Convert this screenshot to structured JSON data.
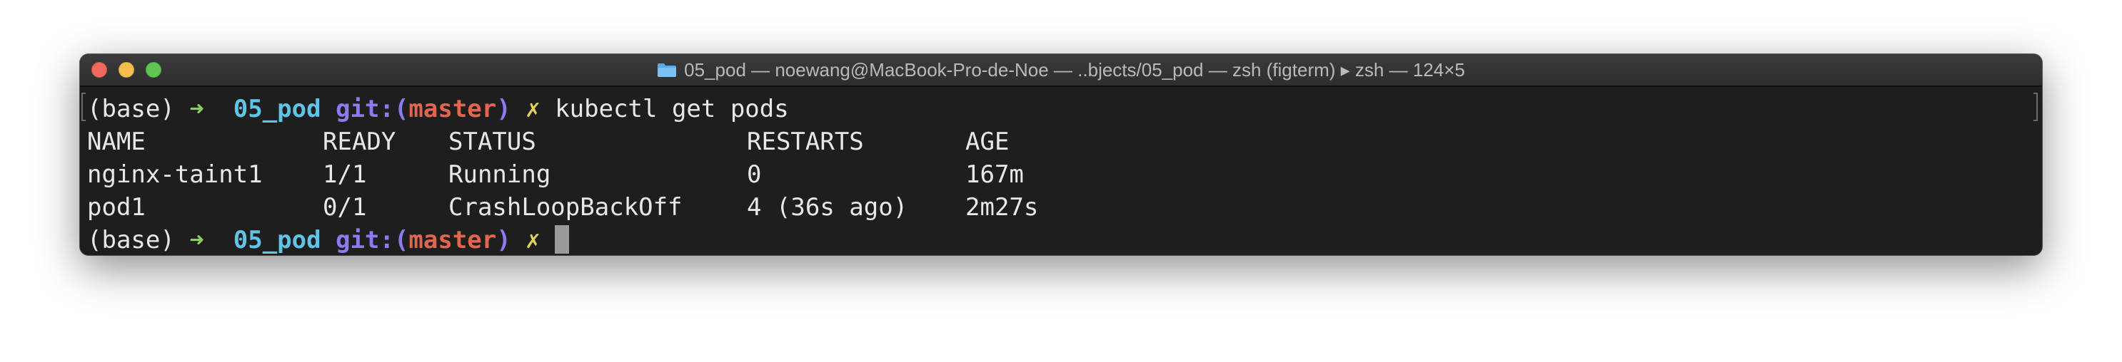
{
  "window": {
    "title": "05_pod — noewang@MacBook-Pro-de-Noe — ..bjects/05_pod — zsh (figterm) ▸ zsh — 124×5",
    "folder_icon": "folder-icon",
    "traffic_lights": [
      "close",
      "minimize",
      "zoom"
    ]
  },
  "prompt": {
    "env": "(base)",
    "arrow": "➜",
    "dir": "05_pod",
    "git_label": "git:(",
    "branch": "master",
    "git_close": ")",
    "dirty_mark": "✗"
  },
  "command": "kubectl get pods",
  "table": {
    "headers": [
      "NAME",
      "READY",
      "STATUS",
      "RESTARTS",
      "AGE"
    ],
    "rows": [
      [
        "nginx-taint1",
        "1/1",
        "Running",
        "0",
        "167m"
      ],
      [
        "pod1",
        "0/1",
        "CrashLoopBackOff",
        "4 (36s ago)",
        "2m27s"
      ]
    ]
  },
  "colors": {
    "terminal_bg": "#1e1e1e",
    "arrow": "#8bd05c",
    "dir": "#5ec4e8",
    "git": "#8a7cf0",
    "branch": "#e0664f",
    "dirty_mark": "#e6d15c"
  }
}
